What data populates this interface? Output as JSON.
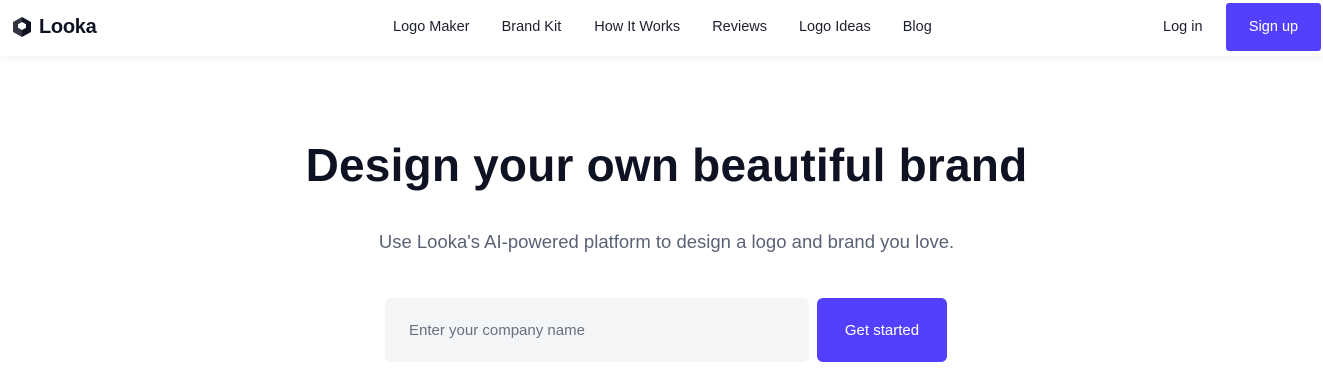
{
  "brand": {
    "name": "Looka",
    "icon": "looka-logo-icon",
    "accent_color": "#5340ff"
  },
  "nav": {
    "links": [
      {
        "label": "Logo Maker"
      },
      {
        "label": "Brand Kit"
      },
      {
        "label": "How It Works"
      },
      {
        "label": "Reviews"
      },
      {
        "label": "Logo Ideas"
      },
      {
        "label": "Blog"
      }
    ],
    "login_label": "Log in",
    "signup_label": "Sign up"
  },
  "hero": {
    "title": "Design your own beautiful brand",
    "subtitle": "Use Looka's AI-powered platform to design a logo and brand you love.",
    "input": {
      "value": "",
      "placeholder": "Enter your company name"
    },
    "cta_label": "Get started"
  }
}
